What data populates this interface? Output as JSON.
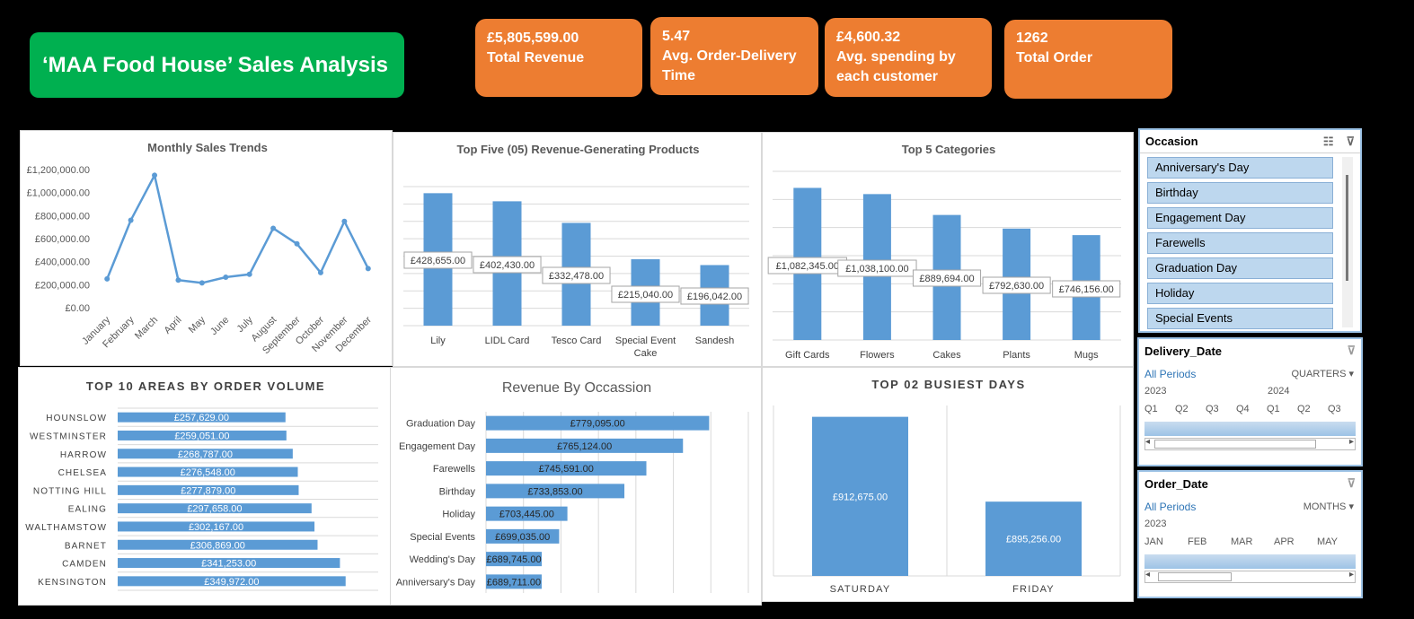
{
  "header": {
    "title": "‘MAA Food House’ Sales Analysis"
  },
  "kpis": [
    {
      "value": "£5,805,599.00",
      "label": "Total Revenue"
    },
    {
      "value": "5.47",
      "label": "Avg. Order-Delivery Time"
    },
    {
      "value": "£4,600.32",
      "label": "Avg. spending by each customer"
    },
    {
      "value": "1262",
      "label": "Total Order"
    }
  ],
  "chart_data": [
    {
      "type": "line",
      "title": "Monthly Sales Trends",
      "categories": [
        "January",
        "February",
        "March",
        "April",
        "May",
        "June",
        "July",
        "August",
        "September",
        "October",
        "November",
        "December"
      ],
      "values": [
        250000,
        760000,
        1150000,
        240000,
        215000,
        265000,
        290000,
        690000,
        555000,
        305000,
        750000,
        340000
      ],
      "ylim": [
        0,
        1200000
      ],
      "yticks": [
        "£0.00",
        "£200,000.00",
        "£400,000.00",
        "£600,000.00",
        "£800,000.00",
        "£1,000,000.00",
        "£1,200,000.00"
      ],
      "color": "#5b9bd5"
    },
    {
      "type": "bar",
      "title": "Top Five (05) Revenue-Generating Products",
      "categories": [
        "Lily",
        "LIDL Card",
        "Tesco Card",
        "Special Event Cake",
        "Sandesh"
      ],
      "values": [
        428655,
        402430,
        332478,
        215040,
        196042
      ],
      "labels": [
        "£428,655.00",
        "£402,430.00",
        "£332,478.00",
        "£215,040.00",
        "£196,042.00"
      ],
      "ylim": [
        0,
        450000
      ],
      "color": "#5b9bd5"
    },
    {
      "type": "bar",
      "title": "Top 5 Categories",
      "categories": [
        "Gift Cards",
        "Flowers",
        "Cakes",
        "Plants",
        "Mugs"
      ],
      "values": [
        1082345,
        1038100,
        889694,
        792630,
        746156
      ],
      "labels": [
        "£1,082,345.00",
        "£1,038,100.00",
        "£889,694.00",
        "£792,630.00",
        "£746,156.00"
      ],
      "ylim": [
        0,
        1200000
      ],
      "color": "#5b9bd5"
    },
    {
      "type": "bar",
      "title": "TOP 10 AREAS BY ORDER VOLUME",
      "orientation": "horizontal",
      "categories": [
        "HOUNSLOW",
        "WESTMINSTER",
        "HARROW",
        "CHELSEA",
        "NOTTING HILL",
        "EALING",
        "WALTHAMSTOW",
        "BARNET",
        "CAMDEN",
        "KENSINGTON"
      ],
      "values": [
        257629,
        259051,
        268787,
        276548,
        277879,
        297658,
        302167,
        306869,
        341253,
        349972
      ],
      "labels": [
        "£257,629.00",
        "£259,051.00",
        "£268,787.00",
        "£276,548.00",
        "£277,879.00",
        "£297,658.00",
        "£302,167.00",
        "£306,869.00",
        "£341,253.00",
        "£349,972.00"
      ],
      "xlim": [
        0,
        400000
      ],
      "color": "#5b9bd5"
    },
    {
      "type": "bar",
      "title": "Revenue By Occassion",
      "orientation": "horizontal",
      "categories": [
        "Graduation Day",
        "Engagement Day",
        "Farewells",
        "Birthday",
        "Holiday",
        "Special Events",
        "Wedding's Day",
        "Anniversary's Day"
      ],
      "values": [
        779095,
        765124,
        745591,
        733853,
        703445,
        699035,
        689745,
        689711
      ],
      "labels": [
        "£779,095.00",
        "£765,124.00",
        "£745,591.00",
        "£733,853.00",
        "£703,445.00",
        "£699,035.00",
        "£689,745.00",
        "£689,711.00"
      ],
      "xlim": [
        660000,
        800000
      ],
      "color": "#5b9bd5"
    },
    {
      "type": "bar",
      "title": "TOP 02 BUSIEST DAYS",
      "categories": [
        "SATURDAY",
        "FRIDAY"
      ],
      "values": [
        912675,
        895256
      ],
      "labels": [
        "£912,675.00",
        "£895,256.00"
      ],
      "ylim": [
        880000,
        915000
      ],
      "color": "#5b9bd5"
    }
  ],
  "slicers": {
    "occasion": {
      "title": "Occasion",
      "items": [
        "Anniversary's Day",
        "Birthday",
        "Engagement Day",
        "Farewells",
        "Graduation Day",
        "Holiday",
        "Special Events"
      ]
    },
    "delivery": {
      "title": "Delivery_Date",
      "all_periods": "All Periods",
      "level": "QUARTERS",
      "years": [
        "2023",
        "2024"
      ],
      "periods": [
        "Q1",
        "Q2",
        "Q3",
        "Q4",
        "Q1",
        "Q2",
        "Q3"
      ]
    },
    "order": {
      "title": "Order_Date",
      "all_periods": "All Periods",
      "level": "MONTHS",
      "years": [
        "2023"
      ],
      "periods": [
        "JAN",
        "FEB",
        "MAR",
        "APR",
        "MAY"
      ]
    }
  },
  "icons": {
    "multi_select": "multi-select-icon",
    "clear_filter": "clear-filter-icon",
    "dropdown": "dropdown-arrow-icon"
  }
}
